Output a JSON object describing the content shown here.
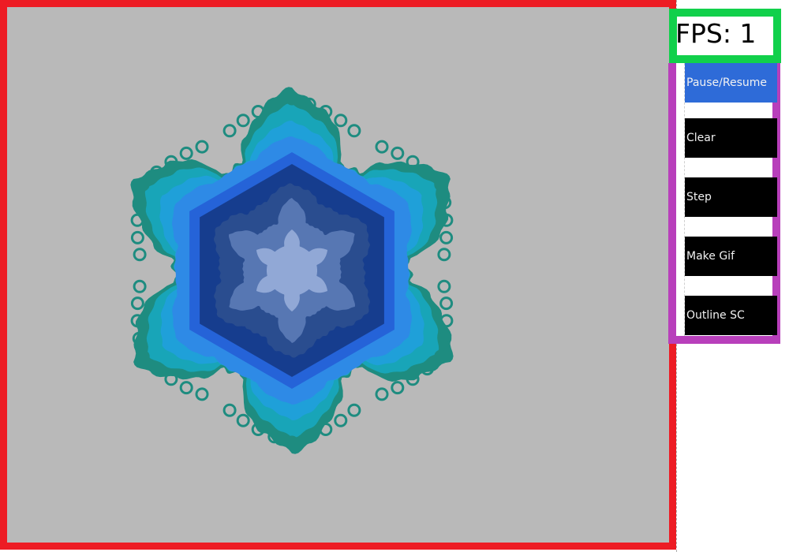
{
  "canvas": {
    "background": "#b9b9b9",
    "frame_color": "#ed1c24",
    "snowflake": {
      "symmetry": 6,
      "layers": [
        {
          "name": "outer-fringe",
          "color": "#1e8c80"
        },
        {
          "name": "teal",
          "color": "#18a5b8"
        },
        {
          "name": "cyan-blue",
          "color": "#1fa0d9"
        },
        {
          "name": "sky-blue",
          "color": "#2e8ae6"
        },
        {
          "name": "royal-blue",
          "color": "#2563d8"
        },
        {
          "name": "navy",
          "color": "#163d8e"
        },
        {
          "name": "slate-blue",
          "color": "#2a4d8f"
        },
        {
          "name": "steel-blue",
          "color": "#5777b3"
        },
        {
          "name": "pale-blue",
          "color": "#91a8d6"
        }
      ]
    }
  },
  "fps": {
    "label": "FPS: 1",
    "border_color": "#11d04b"
  },
  "controls": {
    "border_color": "#b83fbb",
    "buttons": [
      {
        "label": "Pause/Resume",
        "color": "#2e6bd8"
      },
      {
        "label": "Clear",
        "color": "#000000"
      },
      {
        "label": "Step",
        "color": "#000000"
      },
      {
        "label": "Make Gif",
        "color": "#000000"
      },
      {
        "label": "Outline SC",
        "color": "#000000"
      }
    ]
  }
}
